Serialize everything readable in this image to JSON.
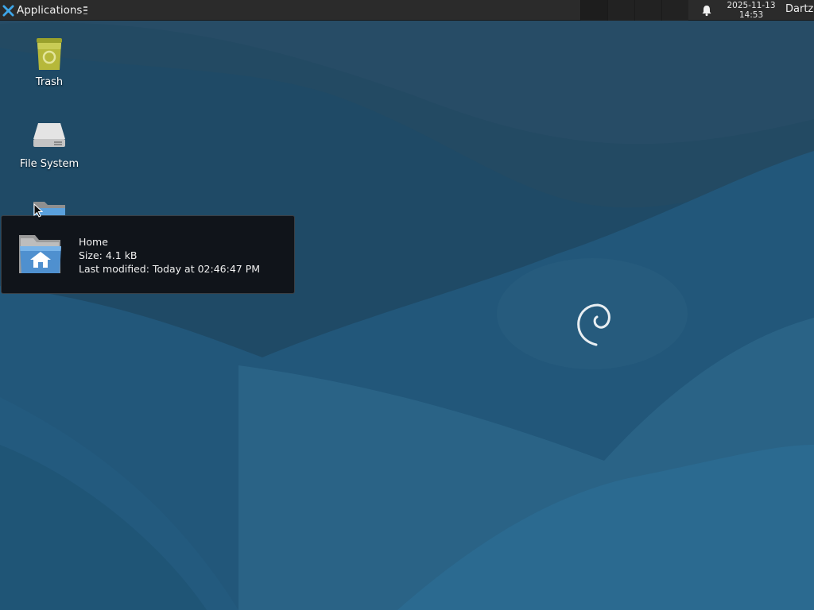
{
  "panel": {
    "applications_label": "Applications",
    "clock_date": "2025-11-13",
    "clock_time": "14:53",
    "user_name": "Dartz",
    "workspace_count": 4
  },
  "desktop": {
    "icons": [
      {
        "label": "Trash",
        "icon": "trash-icon"
      },
      {
        "label": "File System",
        "icon": "drive-icon"
      },
      {
        "label": "Home",
        "icon": "home-folder-icon"
      }
    ]
  },
  "tooltip": {
    "name": "Home",
    "size": "Size: 4.1 kB",
    "modified": "Last modified: Today at 02:46:47 PM"
  },
  "colors": {
    "panel_bg": "#2b2b2b",
    "wallpaper_base": "#1f4e6b",
    "tooltip_bg": "#10141a",
    "trash_green": "#b6b83a"
  }
}
